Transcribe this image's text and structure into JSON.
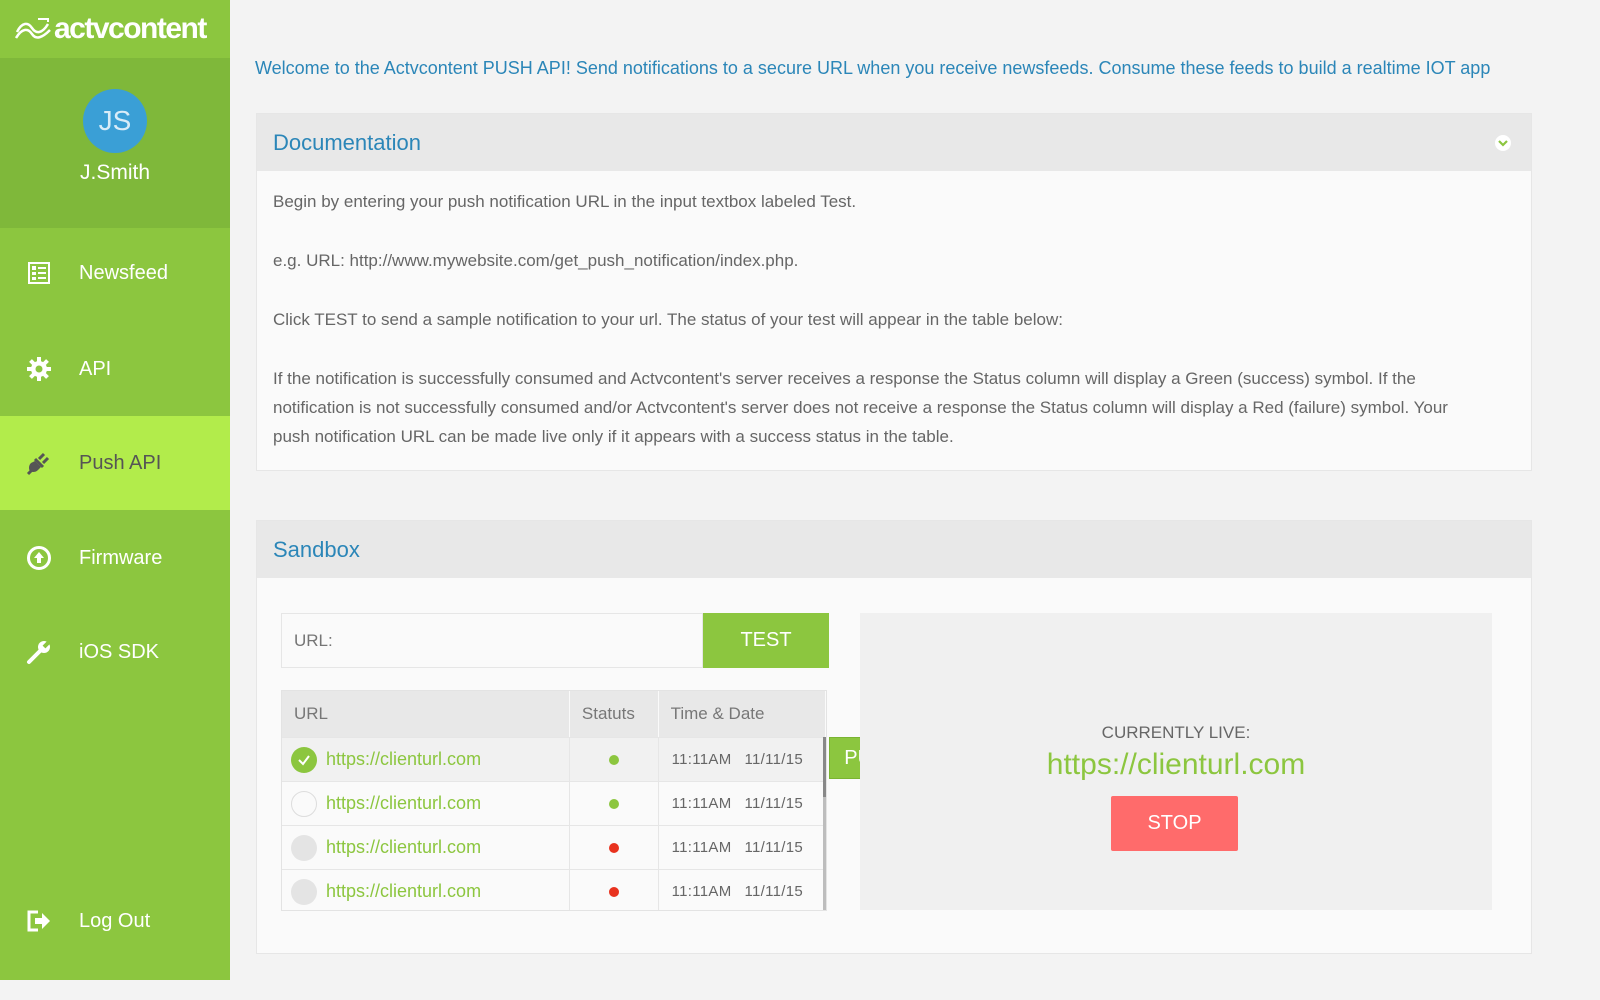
{
  "app": {
    "logo_text": "actvcontent"
  },
  "user": {
    "initials": "JS",
    "name": "J.Smith"
  },
  "sidebar": {
    "items": [
      {
        "label": "Newsfeed",
        "icon": "newspaper-icon"
      },
      {
        "label": "API",
        "icon": "gear-icon"
      },
      {
        "label": "Push API",
        "icon": "plug-icon",
        "active": true
      },
      {
        "label": "Firmware",
        "icon": "upload-circle-icon"
      },
      {
        "label": "iOS SDK",
        "icon": "wrench-icon"
      }
    ],
    "logout": {
      "label": "Log Out",
      "icon": "logout-icon"
    }
  },
  "welcome": "Welcome to the Actvcontent PUSH API! Send notifications to a secure URL when you receive newsfeeds. Consume these feeds to build a realtime IOT app",
  "documentation": {
    "title": "Documentation",
    "paragraphs": [
      "Begin by entering your push notification URL in the input textbox labeled Test.",
      "e.g. URL: http://www.mywebsite.com/get_push_notification/index.php.",
      "Click TEST to send a sample notification to your url. The status of your test will appear in the table below:",
      "If the notification is successfully consumed and Actvcontent's server receives a response the Status column will display a Green (success) symbol. If the notification is not successfully consumed and/or Actvcontent's server does not receive a response the Status column will display a Red (failure) symbol. Your push notification URL can be made live only if it appears with a success status in the table."
    ]
  },
  "sandbox": {
    "title": "Sandbox",
    "url_placeholder": "URL:",
    "test_label": "TEST",
    "columns": [
      "URL",
      "Statuts",
      "Time & Date"
    ],
    "rows": [
      {
        "url": "https://clienturl.com",
        "status": "success",
        "time": "11:11AM",
        "date": "11/11/15",
        "selected": true
      },
      {
        "url": "https://clienturl.com",
        "status": "success",
        "time": "11:11AM",
        "date": "11/11/15",
        "selected": false
      },
      {
        "url": "https://clienturl.com",
        "status": "failure",
        "time": "11:11AM",
        "date": "11/11/15",
        "selected": false
      },
      {
        "url": "https://clienturl.com",
        "status": "failure",
        "time": "11:11AM",
        "date": "11/11/15",
        "selected": false
      }
    ],
    "push_live_label": "PUSH LIVE",
    "currently_live_label": "CURRENTLY LIVE:",
    "currently_live_url": "https://clienturl.com",
    "stop_label": "STOP"
  },
  "colors": {
    "brand_green": "#8cc63f",
    "active_green": "#b2ec4b",
    "accent_blue": "#2b86b8",
    "success": "#8cc63f",
    "failure": "#e8321e",
    "stop_red": "#ff6b6b"
  }
}
